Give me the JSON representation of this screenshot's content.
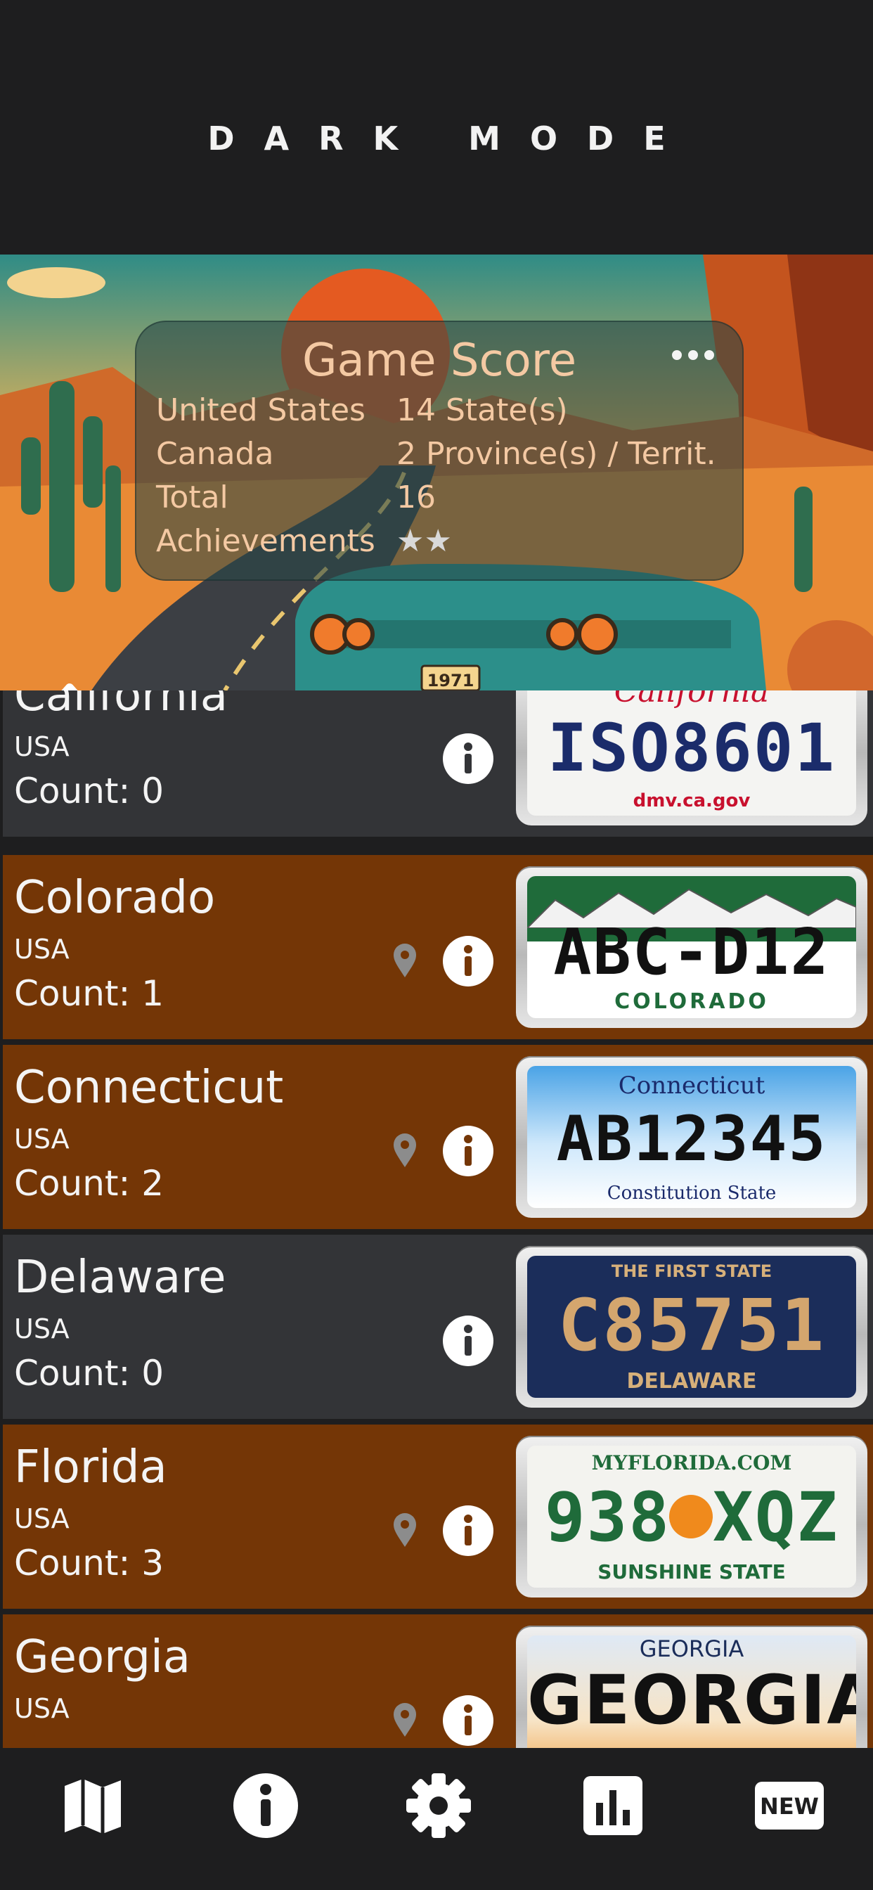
{
  "header": {
    "title": "DARK MODE"
  },
  "score": {
    "title": "Game Score",
    "rows": [
      {
        "label": "United States",
        "value": "14 State(s)"
      },
      {
        "label": "Canada",
        "value": "2 Province(s) / Territ."
      },
      {
        "label": "Total",
        "value": "16"
      },
      {
        "label": "Achievements",
        "value": "★★"
      }
    ]
  },
  "banner": {
    "plate_year": "1971"
  },
  "list": {
    "count_prefix": "Count: ",
    "items": [
      {
        "name": "California",
        "country": "USA",
        "count": "Count: 0",
        "found": false,
        "plate": {
          "top": "California",
          "number": "ISO8601",
          "bottom": "dmv.ca.gov"
        }
      },
      {
        "name": "Colorado",
        "country": "USA",
        "count": "Count: 1",
        "found": true,
        "plate": {
          "top": "",
          "number": "ABC-D12",
          "bottom": "COLORADO"
        }
      },
      {
        "name": "Connecticut",
        "country": "USA",
        "count": "Count: 2",
        "found": true,
        "plate": {
          "top": "Connecticut",
          "number": "AB12345",
          "bottom": "Constitution State"
        }
      },
      {
        "name": "Delaware",
        "country": "USA",
        "count": "Count: 0",
        "found": false,
        "plate": {
          "top": "THE FIRST STATE",
          "number": "C85751",
          "bottom": "DELAWARE"
        }
      },
      {
        "name": "Florida",
        "country": "USA",
        "count": "Count: 3",
        "found": true,
        "plate": {
          "top": "MYFLORIDA.COM",
          "number": "938 XQZ",
          "bottom": "SUNSHINE STATE"
        }
      },
      {
        "name": "Georgia",
        "country": "USA",
        "count": "",
        "found": true,
        "plate": {
          "top": "GEORGIA",
          "number": "GEORGIA",
          "bottom": ""
        }
      }
    ]
  },
  "nav": {
    "items": [
      "map-icon",
      "info-icon",
      "gear-icon",
      "chart-icon",
      "new-icon"
    ],
    "new_label": "NEW"
  },
  "colors": {
    "background": "#1e1e1f",
    "found_row": "#743606",
    "notfound_row": "#333437",
    "score_text": "#f4c9a3"
  }
}
